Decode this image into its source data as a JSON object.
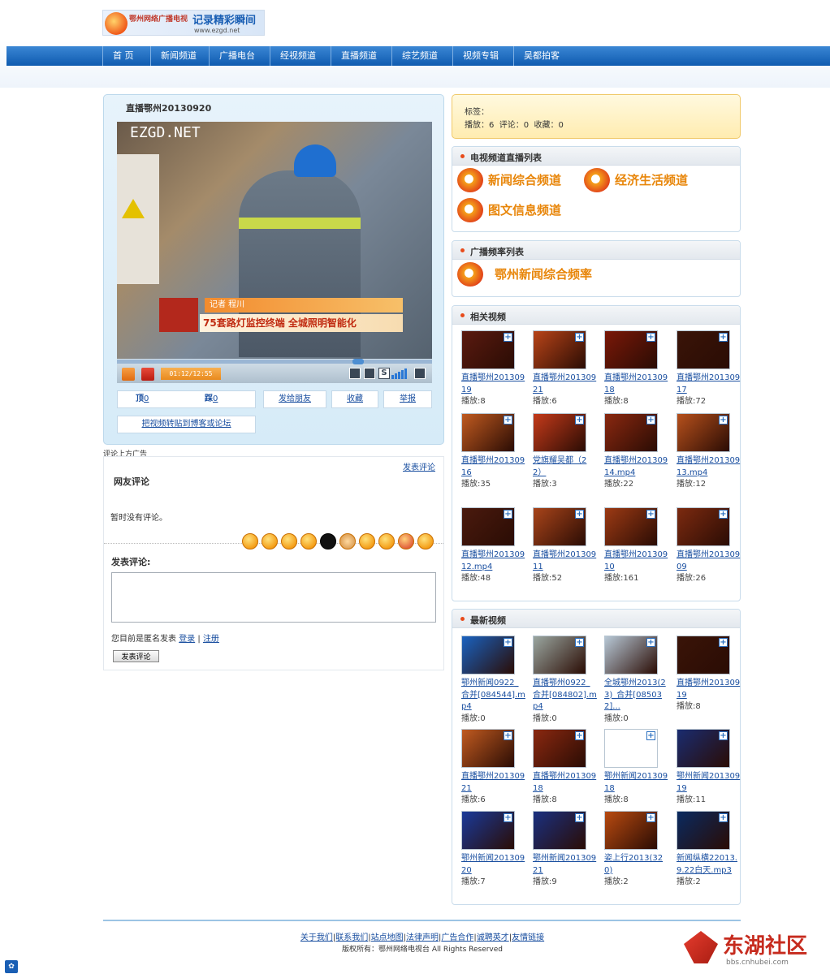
{
  "header": {
    "logo_line1": "鄂州网络广播电视",
    "logo_slogan": "记录精彩瞬间",
    "logo_url": "www.ezgd.net"
  },
  "nav": [
    "首 页",
    "新闻频道",
    "广播电台",
    "经视频道",
    "直播频道",
    "综艺频道",
    "视频专辑",
    "吴都拍客"
  ],
  "player": {
    "title": "直播鄂州20130920",
    "watermark": "EZGD.NET",
    "caption_reporter": "记者  程川",
    "caption_headline": "75套路灯监控终端  全城照明智能化",
    "time": "01:12/12:55",
    "actions": {
      "up_label": "顶",
      "up_count": "0",
      "down_label": "踩",
      "down_count": "0",
      "share_friend": "发给朋友",
      "favorite": "收藏",
      "report": "举报",
      "repost": "把视频转贴到博客或论坛"
    }
  },
  "info": {
    "tags_label": "标签：",
    "stats": "播放：6  评论：0  收藏：0"
  },
  "tv_live": {
    "title": "电视频道直播列表",
    "channels": [
      "新闻综合频道",
      "经济生活频道",
      "图文信息频道"
    ]
  },
  "radio": {
    "title": "广播频率列表",
    "channels": [
      "鄂州新闻综合频率"
    ]
  },
  "comments": {
    "ad_label": "评论上方广告",
    "post_link": "发表评论",
    "title": "网友评论",
    "empty": "暂时没有评论。",
    "form_title": "发表评论:",
    "anon_text": "您目前是匿名发表",
    "login": "登录",
    "sep": "|",
    "register": "注册",
    "submit": "发表评论"
  },
  "related": {
    "title": "相关视频",
    "items": [
      {
        "title": "直播鄂州20130919",
        "count": "播放:8"
      },
      {
        "title": "直播鄂州20130921",
        "count": "播放:6"
      },
      {
        "title": "直播鄂州20130918",
        "count": "播放:8"
      },
      {
        "title": "直播鄂州20130917",
        "count": "播放:72"
      },
      {
        "title": "直播鄂州20130916",
        "count": "播放:35"
      },
      {
        "title": "党旗耀吴都（22）",
        "count": "播放:3"
      },
      {
        "title": "直播鄂州20130914.mp4",
        "count": "播放:22"
      },
      {
        "title": "直播鄂州20130913.mp4",
        "count": "播放:12"
      },
      {
        "title": "直播鄂州20130912.mp4",
        "count": "播放:48"
      },
      {
        "title": "直播鄂州20130911",
        "count": "播放:52"
      },
      {
        "title": "直播鄂州20130910",
        "count": "播放:161"
      },
      {
        "title": "直播鄂州20130909",
        "count": "播放:26"
      }
    ]
  },
  "latest": {
    "title": "最新视频",
    "items": [
      {
        "title": "鄂州新闻0922_合并[084544].mp4",
        "count": "播放:0"
      },
      {
        "title": "直播鄂州0922_合并[084802].mp4",
        "count": "播放:0"
      },
      {
        "title": "全城鄂州2013(23)_合并[085032]...",
        "count": "播放:0"
      },
      {
        "title": "直播鄂州20130919",
        "count": "播放:8"
      },
      {
        "title": "直播鄂州20130921",
        "count": "播放:6"
      },
      {
        "title": "直播鄂州20130918",
        "count": "播放:8"
      },
      {
        "title": "鄂州新闻20130918",
        "count": "播放:8"
      },
      {
        "title": "鄂州新闻20130919",
        "count": "播放:11"
      },
      {
        "title": "鄂州新闻20130920",
        "count": "播放:7"
      },
      {
        "title": "鄂州新闻20130921",
        "count": "播放:9"
      },
      {
        "title": "姿上行2013(320)",
        "count": "播放:2"
      },
      {
        "title": "新闻纵横22013.9.22白天.mp3",
        "count": "播放:2"
      }
    ]
  },
  "footer": {
    "links": [
      "关于我们",
      "联系我们",
      "站点地图",
      "法律声明",
      "广告合作",
      "诚聘英才",
      "友情链接"
    ],
    "copyright": "版权所有：鄂州网络电视台 All Rights Reserved"
  },
  "watermark": {
    "brand": "东湖社区",
    "url": "bbs.cnhubei.com"
  }
}
